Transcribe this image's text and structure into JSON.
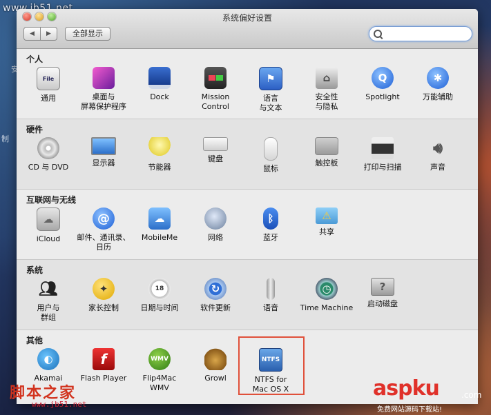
{
  "watermark_top": "www.jb51.net",
  "desktop_fragments": [
    "安",
    "制"
  ],
  "window": {
    "title": "系统偏好设置",
    "back_icon": "chevron-left-icon",
    "forward_icon": "chevron-right-icon",
    "show_all_label": "全部显示",
    "search_placeholder": ""
  },
  "sections": [
    {
      "title": "个人",
      "items": [
        {
          "label": "通用",
          "icon": "general-icon"
        },
        {
          "label": "桌面与\n屏幕保护程序",
          "icon": "desktop-icon"
        },
        {
          "label": "Dock",
          "icon": "dock-icon"
        },
        {
          "label": "Mission\nControl",
          "icon": "mission-control-icon"
        },
        {
          "label": "语言\n与文本",
          "icon": "language-icon"
        },
        {
          "label": "安全性\n与隐私",
          "icon": "security-icon"
        },
        {
          "label": "Spotlight",
          "icon": "spotlight-icon"
        },
        {
          "label": "万能辅助",
          "icon": "accessibility-icon"
        }
      ]
    },
    {
      "title": "硬件",
      "items": [
        {
          "label": "CD 与 DVD",
          "icon": "cd-icon"
        },
        {
          "label": "显示器",
          "icon": "display-icon"
        },
        {
          "label": "节能器",
          "icon": "energy-icon"
        },
        {
          "label": "键盘",
          "icon": "keyboard-icon"
        },
        {
          "label": "鼠标",
          "icon": "mouse-icon"
        },
        {
          "label": "触控板",
          "icon": "trackpad-icon"
        },
        {
          "label": "打印与扫描",
          "icon": "printer-icon"
        },
        {
          "label": "声音",
          "icon": "sound-icon"
        }
      ]
    },
    {
      "title": "互联网与无线",
      "items": [
        {
          "label": "iCloud",
          "icon": "icloud-icon"
        },
        {
          "label": "邮件、通讯录、\n日历",
          "icon": "mail-icon"
        },
        {
          "label": "MobileMe",
          "icon": "mobileme-icon"
        },
        {
          "label": "网络",
          "icon": "network-icon"
        },
        {
          "label": "蓝牙",
          "icon": "bluetooth-icon"
        },
        {
          "label": "共享",
          "icon": "sharing-icon"
        }
      ]
    },
    {
      "title": "系统",
      "items": [
        {
          "label": "用户与\n群组",
          "icon": "users-icon"
        },
        {
          "label": "家长控制",
          "icon": "parental-icon"
        },
        {
          "label": "日期与时间",
          "icon": "clock-icon"
        },
        {
          "label": "软件更新",
          "icon": "update-icon"
        },
        {
          "label": "语音",
          "icon": "microphone-icon"
        },
        {
          "label": "Time Machine",
          "icon": "time-machine-icon"
        },
        {
          "label": "启动磁盘",
          "icon": "disk-icon"
        }
      ]
    },
    {
      "title": "其他",
      "items": [
        {
          "label": "Akamai",
          "icon": "akamai-icon"
        },
        {
          "label": "Flash Player",
          "icon": "flash-icon"
        },
        {
          "label": "Flip4Mac\nWMV",
          "icon": "flip4mac-icon"
        },
        {
          "label": "Growl",
          "icon": "growl-icon"
        },
        {
          "label": "NTFS for\nMac OS X",
          "icon": "ntfs-icon"
        }
      ]
    }
  ],
  "icon_glyphs": {
    "ntfs": "NTFS",
    "flip4mac": "WMV",
    "flash": "f",
    "spotlight": "Q",
    "bluetooth": "ᛒ",
    "mail": "@",
    "clock": "18"
  },
  "colors": {
    "highlight": "#e0503a",
    "window_bg": "#ececec"
  },
  "watermark_bottom_left": "脚本之家",
  "watermark_bottom_left_url": "www.jb51.net",
  "watermark_bottom_right": "aspku",
  "watermark_bottom_right_suffix": ".com",
  "watermark_bottom_right_sub": "免费网站源码下载站!"
}
